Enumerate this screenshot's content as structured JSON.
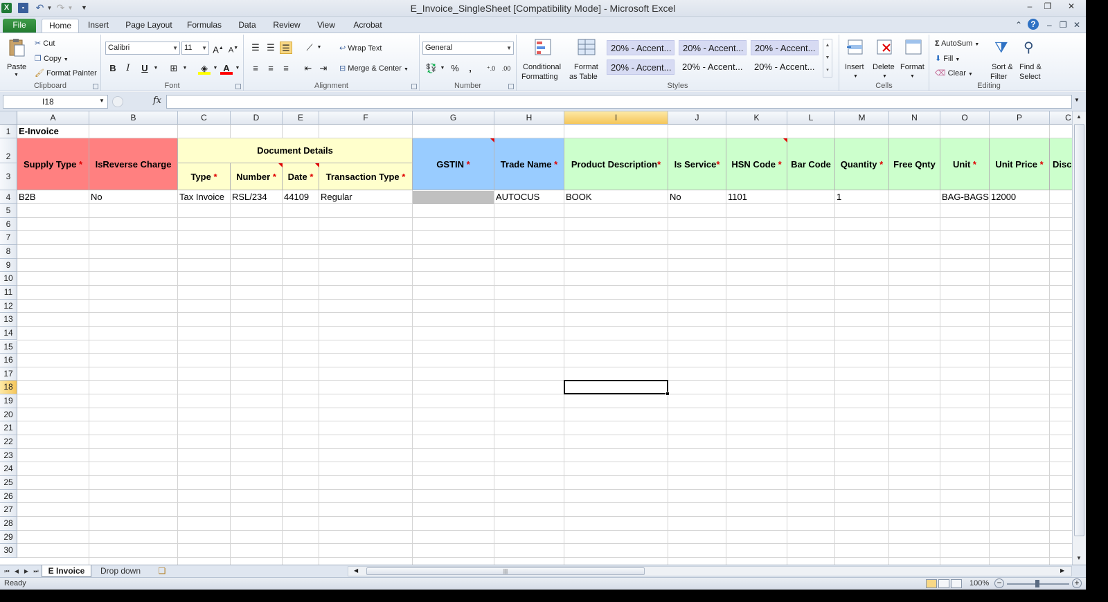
{
  "window": {
    "title": "E_Invoice_SingleSheet  [Compatibility Mode]  -  Microsoft Excel",
    "app_icon": "X"
  },
  "tabs": [
    "File",
    "Home",
    "Insert",
    "Page Layout",
    "Formulas",
    "Data",
    "Review",
    "View",
    "Acrobat"
  ],
  "ribbon": {
    "clipboard": {
      "label": "Clipboard",
      "paste": "Paste",
      "cut": "Cut",
      "copy": "Copy",
      "format_painter": "Format Painter"
    },
    "font": {
      "label": "Font",
      "name": "Calibri",
      "size": "11",
      "bold": "B",
      "italic": "I",
      "underline": "U"
    },
    "alignment": {
      "label": "Alignment",
      "wrap_text": "Wrap Text",
      "merge_center": "Merge & Center"
    },
    "number": {
      "label": "Number",
      "format": "General",
      "percent": "%",
      "comma": ","
    },
    "styles": {
      "label": "Styles",
      "conditional_formatting": [
        "Conditional",
        "Formatting"
      ],
      "format_as_table": [
        "Format",
        "as Table"
      ],
      "cells": [
        "20% - Accent...",
        "20% - Accent...",
        "20% - Accent...",
        "20% - Accent...",
        "20% - Accent...",
        "20% - Accent..."
      ]
    },
    "cells": {
      "label": "Cells",
      "insert": "Insert",
      "delete": "Delete",
      "format": "Format"
    },
    "editing": {
      "label": "Editing",
      "autosum": "AutoSum",
      "fill": "Fill",
      "clear": "Clear",
      "sort_filter": [
        "Sort &",
        "Filter"
      ],
      "find_select": [
        "Find &",
        "Select"
      ]
    }
  },
  "formula_bar": {
    "name_box": "I18",
    "fx": "fx",
    "formula": ""
  },
  "columns": [
    "A",
    "B",
    "C",
    "D",
    "E",
    "F",
    "G",
    "H",
    "I",
    "J",
    "K",
    "L",
    "M",
    "N",
    "O",
    "P",
    "C"
  ],
  "selected_column": "I",
  "selected_row": "18",
  "rows": [
    "1",
    "2",
    "3",
    "4",
    "5",
    "6",
    "7",
    "8",
    "9",
    "10",
    "11",
    "12",
    "13",
    "14",
    "15",
    "16",
    "17",
    "18",
    "19",
    "20",
    "21",
    "22",
    "23",
    "24",
    "25",
    "26",
    "27",
    "28",
    "29",
    "30"
  ],
  "sheet": {
    "title": "E-Invoice",
    "headers": {
      "supply_type": "Supply Type",
      "is_reverse_charge": "IsReverse Charge",
      "document_details": "Document Details",
      "type": "Type",
      "number": "Number",
      "date": "Date",
      "transaction_type": "Transaction Type",
      "gstin": "GSTIN",
      "trade_name": "Trade Name",
      "product_description": "Product Description",
      "is_service": "Is Service",
      "hsn_code": "HSN Code",
      "bar_code": "Bar Code",
      "quantity": "Quantity",
      "free_qnty": "Free Qnty",
      "unit": "Unit",
      "unit_price": "Unit Price",
      "disc": "Disc"
    },
    "required_mark": "*",
    "row4": {
      "supply_type": "B2B",
      "is_reverse_charge": "No",
      "type": "Tax Invoice",
      "number": "RSL/234",
      "date": "44109",
      "transaction_type": "Regular",
      "gstin": "",
      "trade_name": "AUTOCUS",
      "product_description": "BOOK",
      "is_service": "No",
      "hsn_code": "1101",
      "bar_code": "",
      "quantity": "1",
      "free_qnty": "",
      "unit": "BAG-BAGS",
      "unit_price": "12000"
    }
  },
  "sheet_tabs": [
    "E Invoice",
    "Drop down"
  ],
  "status": {
    "text": "Ready",
    "zoom": "100%"
  },
  "colors": {
    "header_red": "#ff8080",
    "header_yellow": "#ffffcc",
    "header_blue": "#99ccff",
    "header_green": "#ccffcc",
    "file_tab": "#217a2e",
    "accent_style": "#d7dbf3"
  }
}
